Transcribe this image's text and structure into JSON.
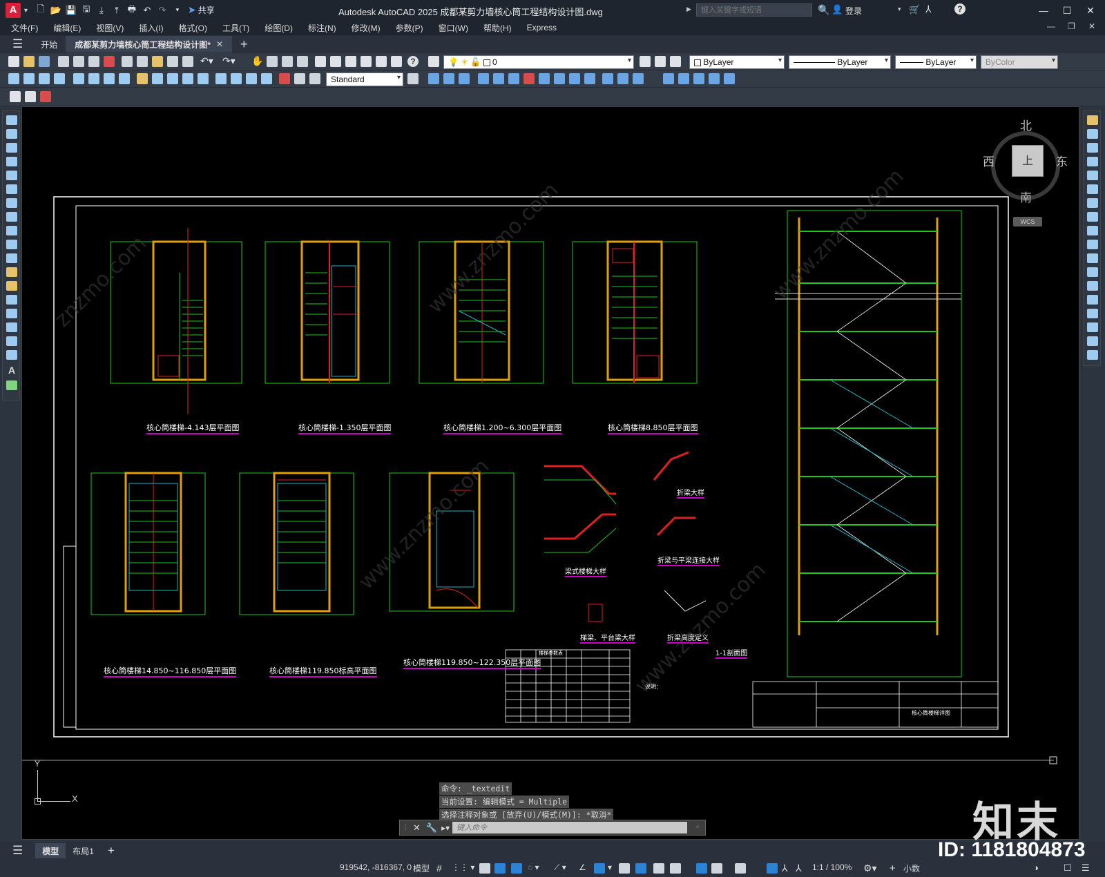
{
  "app": {
    "logo_letter": "A",
    "title": "Autodesk AutoCAD 2025    成都某剪力墙核心筒工程结构设计图.dwg",
    "share_label": "共享",
    "search_placeholder": "键入关键字或短语",
    "sign_in": "登录"
  },
  "menu": [
    "文件(F)",
    "编辑(E)",
    "视图(V)",
    "插入(I)",
    "格式(O)",
    "工具(T)",
    "绘图(D)",
    "标注(N)",
    "修改(M)",
    "参数(P)",
    "窗口(W)",
    "帮助(H)",
    "Express"
  ],
  "tabs": {
    "start": "开始",
    "document": "成都某剪力墙核心筒工程结构设计图*",
    "add": "+"
  },
  "toolbar": {
    "layer_value": "0",
    "color_value": "ByLayer",
    "linetype_value": "ByLayer",
    "lineweight_value": "ByLayer",
    "plotstyle_value": "ByColor",
    "text_style": "Standard"
  },
  "viewcube": {
    "north": "北",
    "south": "南",
    "east": "东",
    "west": "西",
    "top": "上",
    "wcs": "WCS"
  },
  "ucs": {
    "y": "Y",
    "x": "X"
  },
  "drawing": {
    "plans": [
      "核心筒楼梯-4.143层平面图",
      "核心筒楼梯-1.350层平面图",
      "核心筒楼梯1.200~6.300层平面图",
      "核心筒楼梯8.850层平面图",
      "核心筒楼梯14.850~116.850层平面图",
      "核心筒楼梯119.850标高平面图",
      "核心筒楼梯119.850~122.350层平面图"
    ],
    "details": [
      "梁式楼梯大样",
      "折梁大样",
      "折梁与平梁连接大样",
      "梯梁、平台梁大样",
      "折梁高度定义"
    ],
    "section_title": "1-1剖面图",
    "table_title": "楼梯参数表",
    "notes_title": "说明：",
    "title_block_name": "核心筒楼梯详图"
  },
  "command": {
    "history": [
      "命令: _textedit",
      "当前设置: 编辑模式 = Multiple",
      "选择注释对象或 [放弃(U)/模式(M)]: *取消*"
    ],
    "placeholder": "键入命令"
  },
  "layout_tabs": [
    "模型",
    "布局1"
  ],
  "status": {
    "coords": "919542, -816367, 0",
    "model": "模型",
    "scale": "1:1 / 100%",
    "units": "小数"
  },
  "watermark": {
    "brand": "知末",
    "id": "ID: 1181804873"
  }
}
